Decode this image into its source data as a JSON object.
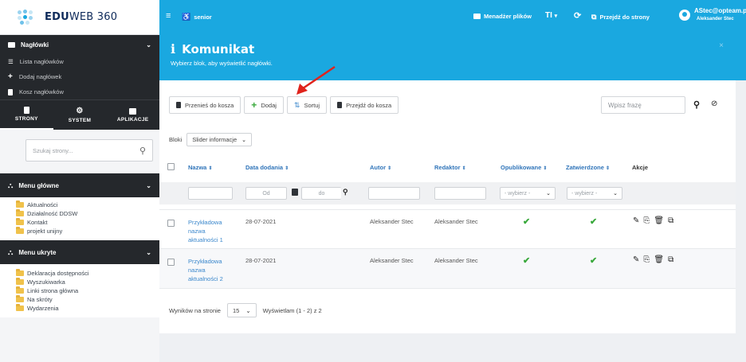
{
  "brand": {
    "name_bold": "EDU",
    "name_rest": "WEB 360"
  },
  "sidebar": {
    "headers_section": {
      "title": "Nagłówki",
      "items": [
        "Lista nagłówków",
        "Dodaj nagłówek",
        "Kosz nagłówków"
      ]
    },
    "tabs": [
      {
        "label": "STRONY",
        "icon": "document-icon"
      },
      {
        "label": "SYSTEM",
        "icon": "gears-icon"
      },
      {
        "label": "APLIKACJE",
        "icon": "monitor-icon"
      }
    ],
    "search_placeholder": "Szukaj strony...",
    "menu_main": {
      "title": "Menu główne",
      "items": [
        "Aktualności",
        "Działalność DDSW",
        "Kontakt",
        "projekt unijny"
      ]
    },
    "menu_hidden": {
      "title": "Menu ukryte",
      "items": [
        "Deklaracja dostępności",
        "Wyszukiwarka",
        "Linki strona główna",
        "Na skróty",
        "Wydarzenia"
      ]
    }
  },
  "topbar": {
    "site": "senior",
    "file_manager": "Menadżer plików",
    "text_size": "TI",
    "go_to_site": "Przejdź do strony",
    "user_email": "AStec@opteam.pl",
    "user_name": "Aleksander Stec"
  },
  "panel": {
    "title": "Komunikat",
    "subtitle": "Wybierz blok, aby wyświetlić nagłówki.",
    "close": "×"
  },
  "toolbar": {
    "trash": "Przenieś do kosza",
    "add": "Dodaj",
    "sort": "Sortuj",
    "go_trash": "Przejdź do kosza",
    "search_placeholder": "Wpisz frazę"
  },
  "blocks": {
    "label": "Bloki",
    "selected": "Slider informacje"
  },
  "table": {
    "columns": [
      "Nazwa",
      "Data dodania",
      "Autor",
      "Redaktor",
      "Opublikowane",
      "Zatwierdzone",
      "Akcje"
    ],
    "sort_marker": "⇕",
    "filters": {
      "date_from": "Od",
      "date_to": "do",
      "published": "- wybierz -",
      "approved": "- wybierz -"
    },
    "rows": [
      {
        "name_lines": [
          "Przykładowa",
          "nazwa",
          "aktualności 1"
        ],
        "date": "28-07-2021",
        "author": "Aleksander Stec",
        "editor": "Aleksander Stec",
        "published": "✔",
        "approved": "✔"
      },
      {
        "name_lines": [
          "Przykładowa",
          "nazwa",
          "aktualności 2"
        ],
        "date": "28-07-2021",
        "author": "Aleksander Stec",
        "editor": "Aleksander Stec",
        "published": "✔",
        "approved": "✔"
      }
    ]
  },
  "pagination": {
    "label": "Wyników na stronie",
    "per_page": "15",
    "info": "Wyświetlam (1 - 2) z 2"
  },
  "colors": {
    "accent": "#1aa8e0",
    "sidebar_dark": "#25282c",
    "check": "#38a83b",
    "link": "#3a87cc",
    "arrow": "#e0231c"
  }
}
